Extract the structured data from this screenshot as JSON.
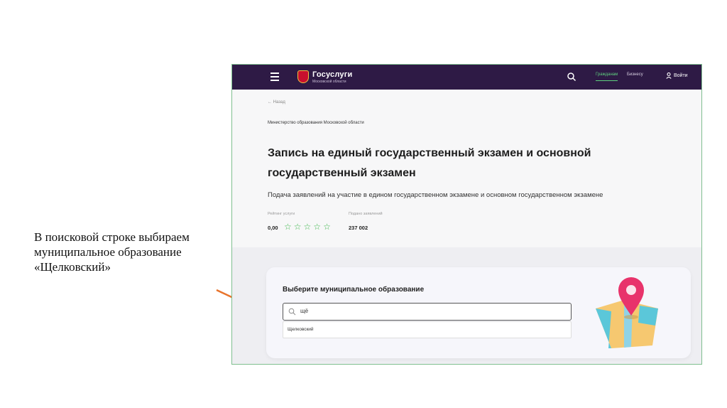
{
  "slide": {
    "caption": "В поисковой строке выбираем муниципальное образование «Щелковский»"
  },
  "colors": {
    "header_bg": "#2e1a45",
    "accent_green": "#3cb64a",
    "arrow": "#e8742c",
    "pin": "#e8336b"
  },
  "header": {
    "brand": "Госуслуги",
    "region": "Московской области",
    "nav": [
      "Гражданам",
      "Бизнесу"
    ],
    "login": "Войти",
    "menu_icon": "hamburger-icon",
    "search_icon": "search-icon",
    "user_icon": "user-icon"
  },
  "page": {
    "back": "Назад",
    "ministry": "Министерство образования Московской области",
    "title": "Запись на единый государственный экзамен и основной государственный экзамен",
    "subtitle": "Подача заявлений на участие в едином государственном экзамене и основном государственном экзамене",
    "rating": {
      "label": "Рейтинг услуги",
      "value": "0,00",
      "stars": 5
    },
    "applications": {
      "label": "Подано заявлений",
      "value": "237 002"
    }
  },
  "municipality": {
    "title": "Выберите муниципальное образование",
    "search_value": "щё",
    "option": "Щелковский"
  }
}
